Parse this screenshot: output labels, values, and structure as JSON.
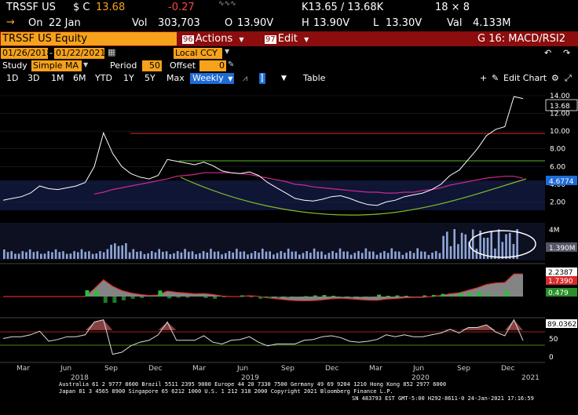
{
  "quote": {
    "ticker": "TRSSF US",
    "currency": "$ C",
    "last": "13.68",
    "change": "-0.27",
    "k_range": "K13.65 / 13.68K",
    "size": "18 × 8",
    "on_label": "On",
    "date": "22 Jan",
    "vol_label": "Vol",
    "volume": "303,703",
    "open_label": "O",
    "open": "13.90V",
    "high_label": "H",
    "high": "13.90V",
    "low_label": "L",
    "low": "13.30V",
    "val_label": "Val",
    "value": "4.133M"
  },
  "toolbar": {
    "security": "TRSSF US Equity",
    "actions_num": "96",
    "actions_label": "Actions",
    "edit_num": "97",
    "edit_label": "Edit",
    "template": "G 16: MACD/RSI2"
  },
  "dates": {
    "start": "01/26/2018",
    "end": "01/22/2021",
    "currency": "Local CCY"
  },
  "study": {
    "label": "Study",
    "type": "Simple MA",
    "period_label": "Period",
    "period": "50",
    "offset_label": "Offset",
    "offset": "0"
  },
  "ranges": [
    "1D",
    "3D",
    "1M",
    "6M",
    "YTD",
    "1Y",
    "5Y",
    "Max"
  ],
  "frequency": "Weekly",
  "table_label": "Table",
  "edit_chart_label": "Edit Chart",
  "chart_data": {
    "type": "line",
    "price_axis": [
      "14.00",
      "12.00",
      "10.00",
      "8.00",
      "6.00",
      "4.00",
      "2.00"
    ],
    "last_price_tag": "13.68",
    "ma_tag": "4.6774",
    "volume_axis": [
      "4M",
      "2M"
    ],
    "volume_tag": "1.390M",
    "macd_axis": [
      "2",
      "0"
    ],
    "macd_tags": [
      "2.2387",
      "1.7390",
      "0.479"
    ],
    "rsi_axis": [
      "100",
      "50",
      "0"
    ],
    "rsi_tag": "89.0362",
    "x_months": [
      "Mar",
      "Jun",
      "Sep",
      "Dec",
      "Mar",
      "Jun",
      "Sep",
      "Dec",
      "Mar",
      "Jun",
      "Sep",
      "Dec"
    ],
    "x_years": [
      "2018",
      "2019",
      "2020",
      "2021"
    ],
    "price_series": [
      2.2,
      2.4,
      2.6,
      3.0,
      3.8,
      3.5,
      3.4,
      3.6,
      3.8,
      4.2,
      6.0,
      9.8,
      7.5,
      6.0,
      5.2,
      4.8,
      4.6,
      5.0,
      6.8,
      6.6,
      6.4,
      6.2,
      6.5,
      6.1,
      5.5,
      5.3,
      5.2,
      5.4,
      5.0,
      4.2,
      3.6,
      3.0,
      2.4,
      2.2,
      2.1,
      2.3,
      2.6,
      2.7,
      2.4,
      2.0,
      1.7,
      1.6,
      2.0,
      2.2,
      2.6,
      2.8,
      3.0,
      3.4,
      4.0,
      5.0,
      5.6,
      6.8,
      8.0,
      9.5,
      10.2,
      10.5,
      13.9,
      13.68
    ],
    "ma50_series": [
      null,
      null,
      null,
      null,
      null,
      null,
      null,
      null,
      null,
      null,
      2.9,
      3.1,
      3.4,
      3.6,
      3.8,
      4.0,
      4.2,
      4.4,
      4.6,
      4.9,
      5.0,
      5.1,
      5.3,
      5.3,
      5.3,
      5.3,
      5.2,
      5.1,
      4.9,
      4.7,
      4.5,
      4.3,
      4.0,
      3.9,
      3.7,
      3.6,
      3.5,
      3.4,
      3.3,
      3.2,
      3.1,
      3.1,
      3.0,
      3.0,
      3.1,
      3.1,
      3.3,
      3.4,
      3.6,
      3.9,
      4.1,
      4.3,
      4.5,
      4.7,
      4.8,
      4.9,
      4.9,
      4.68
    ]
  },
  "footer": {
    "line1": "Australia 61 2 9777 8600 Brazil 5511 2395 9000 Europe 44 20 7330 7500 Germany 49 69 9204 1210 Hong Kong 852 2977 6000",
    "line2": "Japan 81 3 4565 8900        Singapore 65 6212 1000         U.S. 1 212 318 2000                Copyright 2021 Bloomberg Finance L.P.",
    "line3": "SN 483793 EST  GMT-5:00 H292-8611-0 24-Jan-2021 17:16:59"
  },
  "colors": {
    "amber": "#f7a21b",
    "brand_red": "#8b0d0d",
    "price_line": "#ffffff",
    "ma_line": "#cc2a8f",
    "curve_line": "#7fbf2a",
    "resistance_line": "#d92b2b",
    "volume_bar": "#8fa6d8",
    "rsi_fill": "#a85050"
  }
}
